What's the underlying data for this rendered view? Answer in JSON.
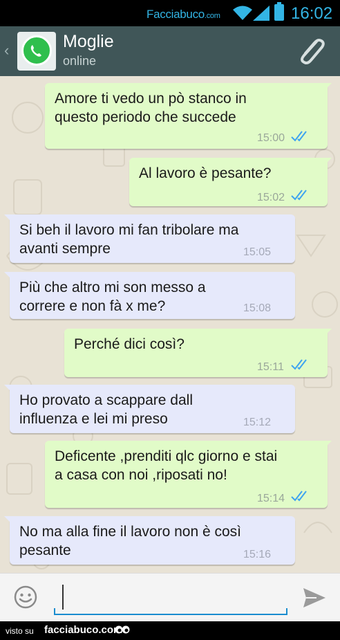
{
  "status_bar": {
    "brand": "Facciabuco",
    "brand_suffix": ".com",
    "time": "16:02",
    "icons": [
      "wifi-icon",
      "signal-icon",
      "battery-icon"
    ]
  },
  "header": {
    "back_icon": "back-chevron-icon",
    "avatar_icon": "whatsapp-icon",
    "contact_name": "Moglie",
    "contact_status": "online",
    "attach_icon": "paperclip-icon",
    "background_color": "#405658"
  },
  "messages": [
    {
      "direction": "out",
      "text": "Amore ti vedo un pò stanco in\nquesto periodo che succede",
      "time": "15:00",
      "read": true
    },
    {
      "direction": "out",
      "text": "Al lavoro è pesante?",
      "time": "15:02",
      "read": true
    },
    {
      "direction": "in",
      "text": "Si beh il lavoro mi fan tribolare ma\navanti sempre",
      "time": "15:05"
    },
    {
      "direction": "in",
      "text": "Più che altro mi son messo a\ncorrere e non fà x me?",
      "time": "15:08"
    },
    {
      "direction": "out",
      "text": "Perché dici così?",
      "time": "15:11",
      "read": true
    },
    {
      "direction": "in",
      "text": "Ho provato a scappare dall\ninfluenza e lei mi preso",
      "time": "15:12"
    },
    {
      "direction": "out",
      "text": "Deficente ,prenditi qlc giorno e stai\na casa con noi ,riposati no!",
      "time": "15:14",
      "read": true
    },
    {
      "direction": "in",
      "text": "No ma alla fine il lavoro non è così\npesante",
      "time": "15:16"
    }
  ],
  "colors": {
    "outgoing_bubble": "#e1fbc8",
    "incoming_bubble": "#e6e9fb",
    "read_ticks": "#3ea4f0",
    "accent": "#33b5e5"
  },
  "input_bar": {
    "emoji_icon": "emoji-icon",
    "message_value": "",
    "send_icon": "send-icon"
  },
  "footer": {
    "visto": "visto su",
    "brand": "facciabuco.com",
    "eyes_icon": "eyes-icon"
  }
}
